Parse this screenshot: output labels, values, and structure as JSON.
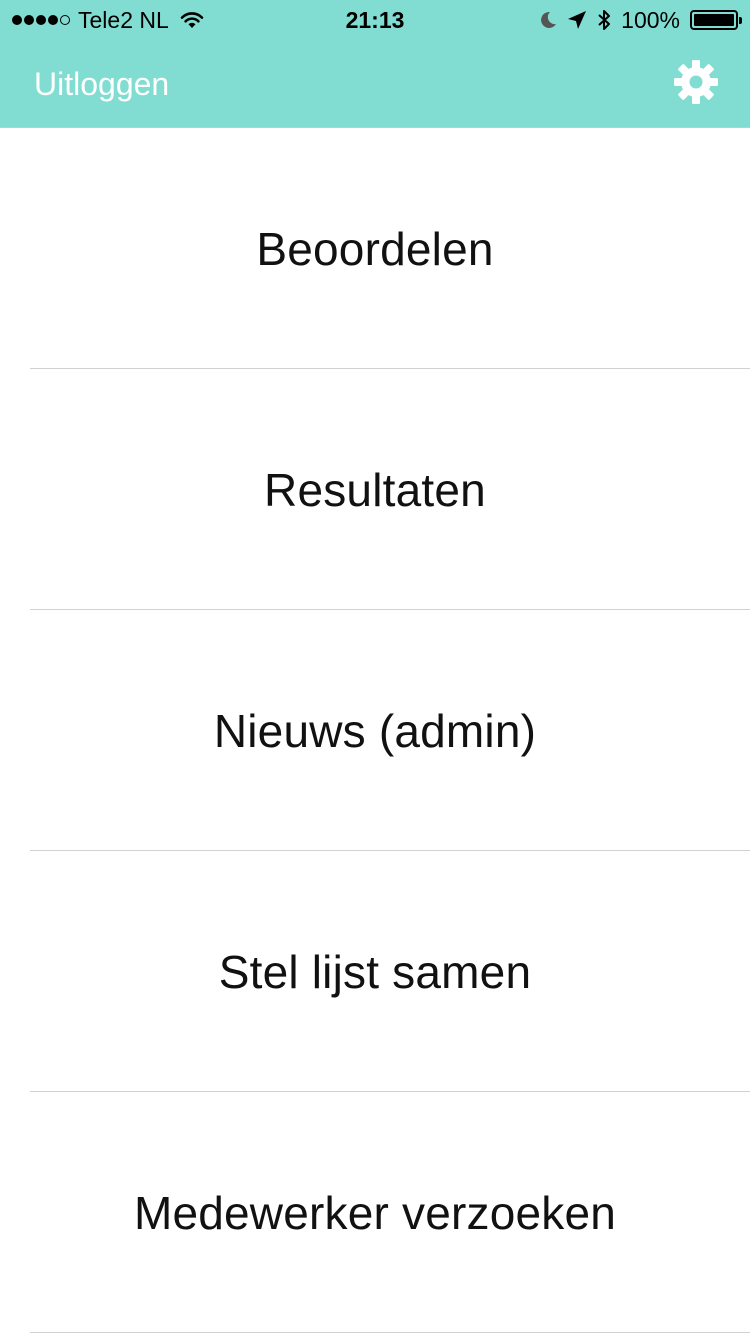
{
  "status_bar": {
    "signal_bars": 4,
    "signal_total": 5,
    "carrier": "Tele2 NL",
    "time": "21:13",
    "battery_percent": "100%",
    "battery_level": 1.0,
    "icons": [
      "wifi-icon",
      "moon-icon",
      "location-arrow-icon",
      "bluetooth-icon",
      "battery-icon"
    ]
  },
  "nav": {
    "logout_label": "Uitloggen",
    "settings_icon": "gear-icon"
  },
  "menu": {
    "items": [
      {
        "label": "Beoordelen"
      },
      {
        "label": "Resultaten"
      },
      {
        "label": "Nieuws (admin)"
      },
      {
        "label": "Stel lijst samen"
      },
      {
        "label": "Medewerker verzoeken"
      }
    ]
  },
  "colors": {
    "header_background": "#81DDD1",
    "nav_text": "#FFFFFF",
    "separator": "#D2D2D2"
  }
}
